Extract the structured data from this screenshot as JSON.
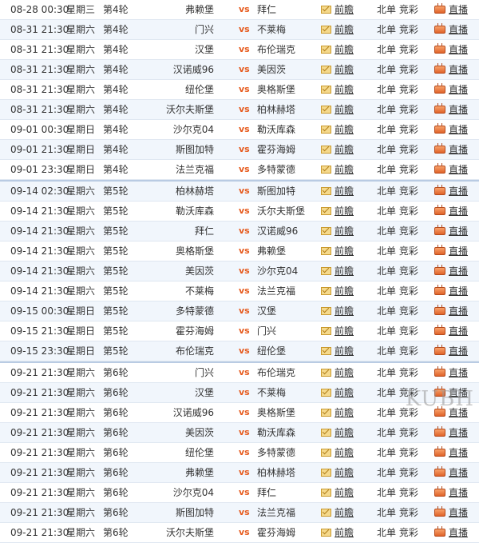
{
  "vs_label": "vs",
  "prediction_label": "前瞻",
  "live_label": "直播",
  "icons": {
    "preview": "envelope-icon",
    "live": "tv-icon"
  },
  "watermark": "KUBH",
  "rows": [
    {
      "time": "08-28 00:30",
      "weekday": "星期三",
      "round": "第4轮",
      "home": "弗赖堡",
      "away": "拜仁",
      "channel": "北单 竞彩"
    },
    {
      "time": "08-31 21:30",
      "weekday": "星期六",
      "round": "第4轮",
      "home": "门兴",
      "away": "不莱梅",
      "channel": "北单 竞彩"
    },
    {
      "time": "08-31 21:30",
      "weekday": "星期六",
      "round": "第4轮",
      "home": "汉堡",
      "away": "布伦瑞克",
      "channel": "北单 竞彩"
    },
    {
      "time": "08-31 21:30",
      "weekday": "星期六",
      "round": "第4轮",
      "home": "汉诺威96",
      "away": "美因茨",
      "channel": "北单 竞彩"
    },
    {
      "time": "08-31 21:30",
      "weekday": "星期六",
      "round": "第4轮",
      "home": "纽伦堡",
      "away": "奥格斯堡",
      "channel": "北单 竞彩"
    },
    {
      "time": "08-31 21:30",
      "weekday": "星期六",
      "round": "第4轮",
      "home": "沃尔夫斯堡",
      "away": "柏林赫塔",
      "channel": "北单 竞彩"
    },
    {
      "time": "09-01 00:30",
      "weekday": "星期日",
      "round": "第4轮",
      "home": "沙尔克04",
      "away": "勒沃库森",
      "channel": "北单 竞彩"
    },
    {
      "time": "09-01 21:30",
      "weekday": "星期日",
      "round": "第4轮",
      "home": "斯图加特",
      "away": "霍芬海姆",
      "channel": "北单 竞彩"
    },
    {
      "time": "09-01 23:30",
      "weekday": "星期日",
      "round": "第4轮",
      "home": "法兰克福",
      "away": "多特蒙德",
      "channel": "北单 竞彩"
    },
    {
      "time": "09-14 02:30",
      "weekday": "星期六",
      "round": "第5轮",
      "home": "柏林赫塔",
      "away": "斯图加特",
      "channel": "北单 竞彩"
    },
    {
      "time": "09-14 21:30",
      "weekday": "星期六",
      "round": "第5轮",
      "home": "勒沃库森",
      "away": "沃尔夫斯堡",
      "channel": "北单 竞彩"
    },
    {
      "time": "09-14 21:30",
      "weekday": "星期六",
      "round": "第5轮",
      "home": "拜仁",
      "away": "汉诺威96",
      "channel": "北单 竞彩"
    },
    {
      "time": "09-14 21:30",
      "weekday": "星期六",
      "round": "第5轮",
      "home": "奥格斯堡",
      "away": "弗赖堡",
      "channel": "北单 竞彩"
    },
    {
      "time": "09-14 21:30",
      "weekday": "星期六",
      "round": "第5轮",
      "home": "美因茨",
      "away": "沙尔克04",
      "channel": "北单 竞彩"
    },
    {
      "time": "09-14 21:30",
      "weekday": "星期六",
      "round": "第5轮",
      "home": "不莱梅",
      "away": "法兰克福",
      "channel": "北单 竞彩"
    },
    {
      "time": "09-15 00:30",
      "weekday": "星期日",
      "round": "第5轮",
      "home": "多特蒙德",
      "away": "汉堡",
      "channel": "北单 竞彩"
    },
    {
      "time": "09-15 21:30",
      "weekday": "星期日",
      "round": "第5轮",
      "home": "霍芬海姆",
      "away": "门兴",
      "channel": "北单 竞彩"
    },
    {
      "time": "09-15 23:30",
      "weekday": "星期日",
      "round": "第5轮",
      "home": "布伦瑞克",
      "away": "纽伦堡",
      "channel": "北单 竞彩"
    },
    {
      "time": "09-21 21:30",
      "weekday": "星期六",
      "round": "第6轮",
      "home": "门兴",
      "away": "布伦瑞克",
      "channel": "北单 竞彩"
    },
    {
      "time": "09-21 21:30",
      "weekday": "星期六",
      "round": "第6轮",
      "home": "汉堡",
      "away": "不莱梅",
      "channel": "北单 竞彩"
    },
    {
      "time": "09-21 21:30",
      "weekday": "星期六",
      "round": "第6轮",
      "home": "汉诺威96",
      "away": "奥格斯堡",
      "channel": "北单 竞彩"
    },
    {
      "time": "09-21 21:30",
      "weekday": "星期六",
      "round": "第6轮",
      "home": "美因茨",
      "away": "勒沃库森",
      "channel": "北单 竞彩"
    },
    {
      "time": "09-21 21:30",
      "weekday": "星期六",
      "round": "第6轮",
      "home": "纽伦堡",
      "away": "多特蒙德",
      "channel": "北单 竞彩"
    },
    {
      "time": "09-21 21:30",
      "weekday": "星期六",
      "round": "第6轮",
      "home": "弗赖堡",
      "away": "柏林赫塔",
      "channel": "北单 竞彩"
    },
    {
      "time": "09-21 21:30",
      "weekday": "星期六",
      "round": "第6轮",
      "home": "沙尔克04",
      "away": "拜仁",
      "channel": "北单 竞彩"
    },
    {
      "time": "09-21 21:30",
      "weekday": "星期六",
      "round": "第6轮",
      "home": "斯图加特",
      "away": "法兰克福",
      "channel": "北单 竞彩"
    },
    {
      "time": "09-21 21:30",
      "weekday": "星期六",
      "round": "第6轮",
      "home": "沃尔夫斯堡",
      "away": "霍芬海姆",
      "channel": "北单 竞彩"
    }
  ]
}
